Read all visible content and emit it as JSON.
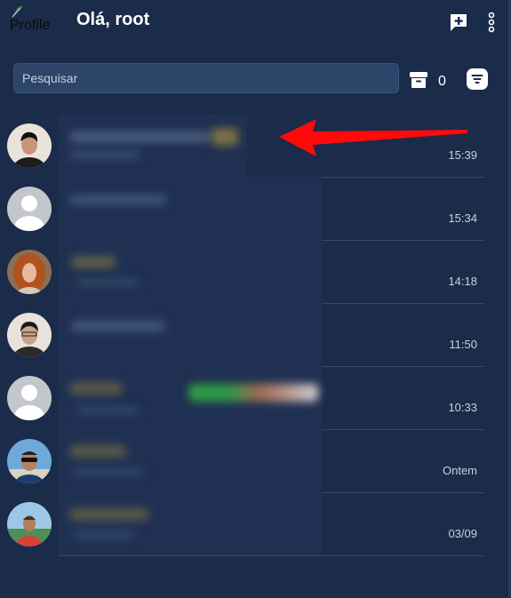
{
  "header": {
    "profile_alt": "Profile",
    "greeting": "Olá, root"
  },
  "search": {
    "placeholder": "Pesquisar"
  },
  "archive": {
    "count": "0"
  },
  "icons": {
    "new_chat": "chat-plus-icon",
    "menu": "more-vertical-icon",
    "archive": "archive-icon",
    "filter": "filter-icon"
  },
  "colors": {
    "background": "#1b2b4a",
    "search_bg": "#2c4568",
    "divider": "#33496c",
    "arrow": "#ff0a0a"
  },
  "chats": [
    {
      "time": "15:39"
    },
    {
      "time": "15:34"
    },
    {
      "time": "14:18"
    },
    {
      "time": "11:50"
    },
    {
      "time": "10:33"
    },
    {
      "time": "Ontem"
    },
    {
      "time": "03/09"
    }
  ]
}
